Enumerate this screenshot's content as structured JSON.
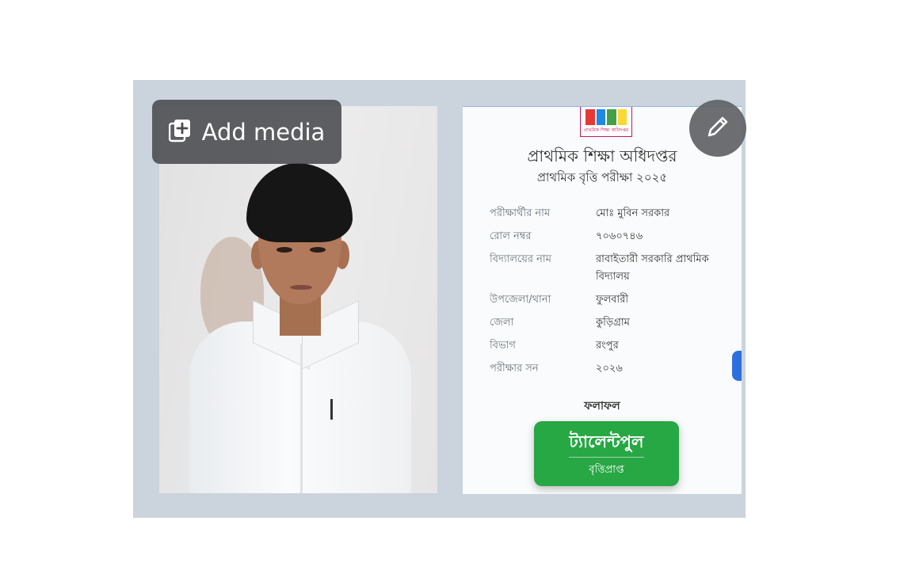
{
  "toolbar": {
    "add_media_label": "Add media",
    "add_media_icon": "add-media-icon",
    "edit_icon": "pencil-icon"
  },
  "certificate": {
    "logo_caption": "প্রাথমিক শিক্ষা অধিদপ্তর",
    "title": "প্রাথমিক শিক্ষা অধিদপ্তর",
    "subtitle": "প্রাথমিক বৃত্তি পরীক্ষা ২০২৫",
    "rows": [
      {
        "key": "পরীক্ষার্থীর নাম",
        "value": "মোঃ মুবিন সরকার"
      },
      {
        "key": "রোল নম্বর",
        "value": "৭০৬০৭৪৬"
      },
      {
        "key": "বিদ্যালয়ের নাম",
        "value": "রাবাইতারী সরকারি প্রাথমিক বিদ্যালয়"
      },
      {
        "key": "উপজেলা/থানা",
        "value": "ফুলবারী"
      },
      {
        "key": "জেলা",
        "value": "কুড়িগ্রাম"
      },
      {
        "key": "বিভাগ",
        "value": "রংপুর"
      },
      {
        "key": "পরীক্ষার সন",
        "value": "২০২৬"
      }
    ],
    "result_label": "ফলাফল",
    "result_value": "ট্যালেন্টপুল",
    "result_sub": "বৃত্তিপ্রাপ্ত"
  },
  "colors": {
    "stage_bg": "#cbd3dc",
    "overlay_bg": "#484a4e",
    "badge_green": "#28a745",
    "side_tab_blue": "#2f6fdc"
  }
}
